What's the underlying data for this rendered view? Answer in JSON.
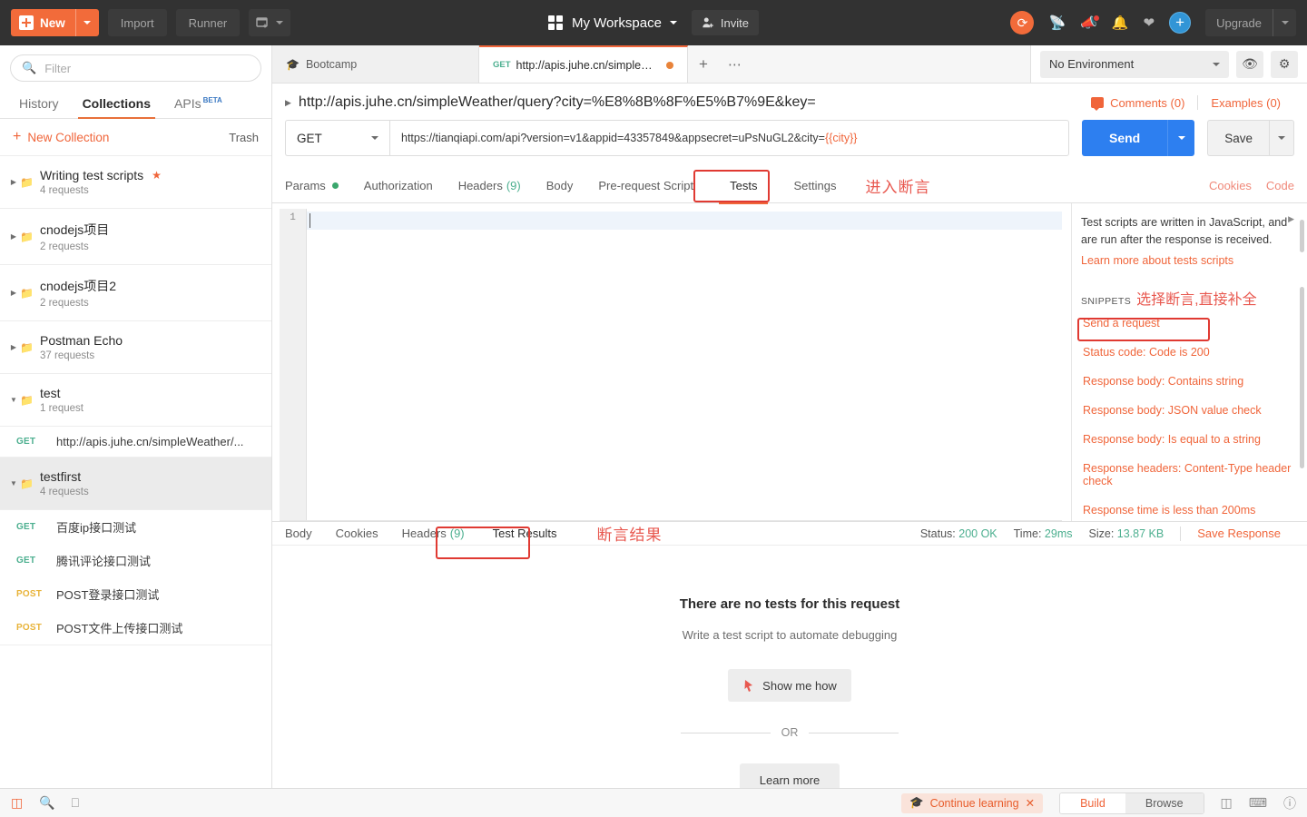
{
  "topbar": {
    "new_label": "New",
    "import_label": "Import",
    "runner_label": "Runner",
    "new_window_icon": "new-window-icon",
    "workspace_name": "My Workspace",
    "invite_label": "Invite",
    "sync_icon": "sync-icon",
    "satellite_icon": "satellite-icon",
    "megaphone_icon": "megaphone-icon",
    "bell_icon": "bell-icon",
    "heart_icon": "heart-icon",
    "plus_icon": "plus-circle-icon",
    "upgrade_label": "Upgrade"
  },
  "sidebar": {
    "filter_placeholder": "Filter",
    "tabs": [
      {
        "label": "History",
        "active": false
      },
      {
        "label": "Collections",
        "active": true
      },
      {
        "label": "APIs",
        "badge": "BETA",
        "active": false
      }
    ],
    "new_collection_label": "New Collection",
    "trash_label": "Trash",
    "collections": [
      {
        "name": "Writing test scripts",
        "count": "4 requests",
        "starred": true,
        "expanded": false
      },
      {
        "name": "cnodejs项目",
        "count": "2 requests",
        "starred": false,
        "expanded": false
      },
      {
        "name": "cnodejs项目2",
        "count": "2 requests",
        "starred": false,
        "expanded": false
      },
      {
        "name": "Postman Echo",
        "count": "37 requests",
        "starred": false,
        "expanded": false
      },
      {
        "name": "test",
        "count": "1 request",
        "starred": false,
        "expanded": true
      },
      {
        "name": "testfirst",
        "count": "4 requests",
        "starred": false,
        "expanded": true,
        "selected": true
      }
    ],
    "test_requests": [
      {
        "method": "GET",
        "name": "http://apis.juhe.cn/simpleWeather/..."
      }
    ],
    "testfirst_requests": [
      {
        "method": "GET",
        "name": "百度ip接口测试"
      },
      {
        "method": "GET",
        "name": "腾讯评论接口测试"
      },
      {
        "method": "POST",
        "name": "POST登录接口测试"
      },
      {
        "method": "POST",
        "name": "POST文件上传接口测试"
      }
    ]
  },
  "request_tabs": [
    {
      "label": "Bootcamp",
      "icon": "graduation-cap-icon",
      "active": false,
      "method": ""
    },
    {
      "label": "http://apis.juhe.cn/simpleWeat...",
      "method": "GET",
      "active": true,
      "unsaved": true
    }
  ],
  "environment": {
    "selected": "No Environment",
    "eye_icon": "eye-icon",
    "gear_icon": "gear-icon"
  },
  "request": {
    "title": "http://apis.juhe.cn/simpleWeather/query?city=%E8%8B%8F%E5%B7%9E&key=",
    "comments_label": "Comments (0)",
    "examples_label": "Examples (0)",
    "method": "GET",
    "url_prefix": "https://tianqiapi.com/api?version=v1&appid=43357849&appsecret=uPsNuGL2&city=",
    "url_variable": "{{city}}",
    "send_label": "Send",
    "save_label": "Save"
  },
  "request_tabs_row": {
    "items": [
      {
        "label": "Params",
        "dot": true,
        "active": false
      },
      {
        "label": "Authorization",
        "active": false
      },
      {
        "label": "Headers",
        "count": "(9)",
        "active": false
      },
      {
        "label": "Body",
        "active": false
      },
      {
        "label": "Pre-request Script",
        "active": false
      },
      {
        "label": "Tests",
        "active": true,
        "highlighted": true
      },
      {
        "label": "Settings",
        "active": false
      }
    ],
    "annotation": "进入断言",
    "cookies_label": "Cookies",
    "code_label": "Code"
  },
  "editor": {
    "line_number": "1"
  },
  "snippets": {
    "intro": "Test scripts are written in JavaScript, and are run after the response is received.",
    "learn_more": "Learn more about tests scripts",
    "heading": "SNIPPETS",
    "annotation": "选择断言,直接补全",
    "items": [
      {
        "label": "Send a request",
        "highlighted": false
      },
      {
        "label": "Status code: Code is 200",
        "highlighted": true
      },
      {
        "label": "Response body: Contains string",
        "highlighted": false
      },
      {
        "label": "Response body: JSON value check",
        "highlighted": false
      },
      {
        "label": "Response body: Is equal to a string",
        "highlighted": false
      },
      {
        "label": "Response headers: Content-Type header check",
        "highlighted": false
      },
      {
        "label": "Response time is less than 200ms",
        "highlighted": false
      }
    ]
  },
  "response": {
    "tabs": [
      {
        "label": "Body",
        "active": false
      },
      {
        "label": "Cookies",
        "active": false
      },
      {
        "label": "Headers",
        "count": "(9)",
        "active": false
      },
      {
        "label": "Test Results",
        "active": true,
        "highlighted": true
      }
    ],
    "annotation": "断言结果",
    "status_label": "Status:",
    "status_value": "200 OK",
    "time_label": "Time:",
    "time_value": "29ms",
    "size_label": "Size:",
    "size_value": "13.87 KB",
    "save_response_label": "Save Response",
    "empty_title": "There are no tests for this request",
    "empty_subtitle": "Write a test script to automate debugging",
    "show_me_how": "Show me how",
    "or_label": "OR",
    "learn_more": "Learn more"
  },
  "statusbar": {
    "sidebar_icon": "sidebar-toggle-icon",
    "find_icon": "search-icon",
    "console_icon": "console-icon",
    "continue_learning": "Continue learning",
    "close_icon": "close-icon",
    "build_label": "Build",
    "browse_label": "Browse",
    "layout_icon": "two-pane-layout-icon",
    "keyboard_icon": "keyboard-shortcuts-icon",
    "help_icon": "help-icon"
  },
  "colors": {
    "accent_orange": "#f0653a",
    "send_blue": "#2d7ff0",
    "get_green": "#4caf8f",
    "post_yellow": "#e8b339",
    "annotation_red": "#e8584f",
    "highlight_border": "#e03a32",
    "topbar_bg": "#323232"
  }
}
